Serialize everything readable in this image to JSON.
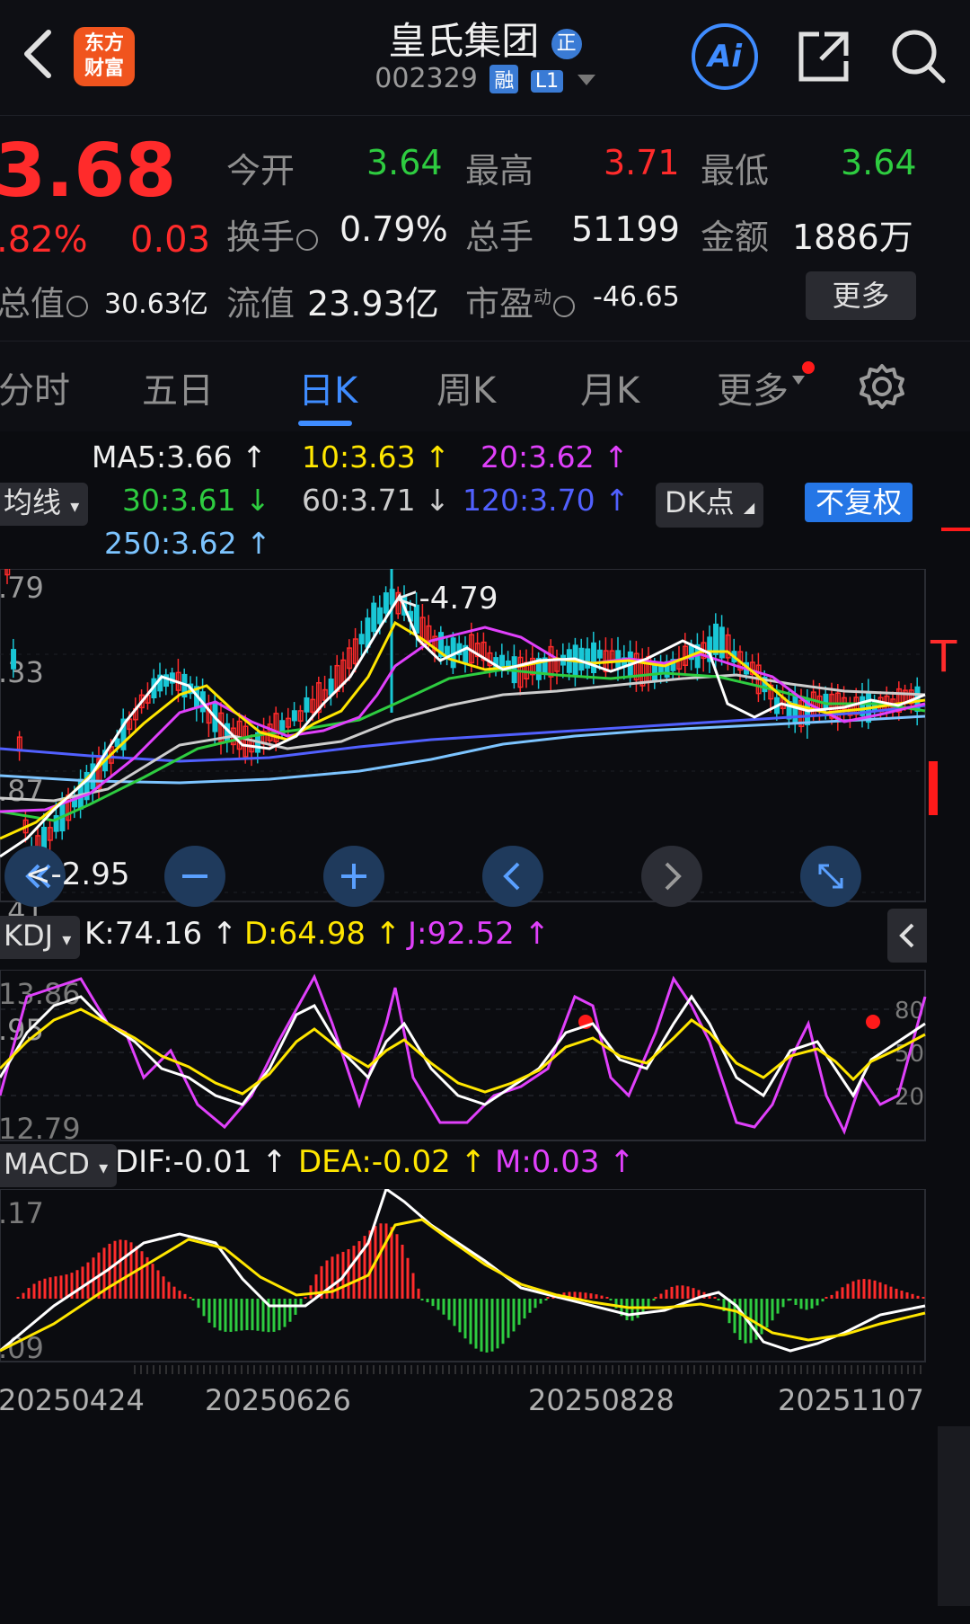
{
  "header": {
    "logo_line1": "东方",
    "logo_line2": "财富",
    "title": "皇氏集团",
    "title_badge": "正",
    "code": "002329",
    "tag_rong": "融",
    "tag_l1": "L1",
    "ai_label": "Ai"
  },
  "quote": {
    "price": "3.68",
    "change_pct": ".82%",
    "change_abs": "0.03",
    "open_label": "今开",
    "open": "3.64",
    "high_label": "最高",
    "high": "3.71",
    "low_label": "最低",
    "low": "3.64",
    "turnover_label": "换手",
    "turnover": "0.79%",
    "volume_label": "总手",
    "volume": "51199",
    "amount_label": "金额",
    "amount": "1886万",
    "mcap_label": "总值",
    "mcap": "30.63亿",
    "float_label": "流值",
    "float_mcap": "23.93亿",
    "pe_label": "市盈",
    "pe_sup": "动",
    "pe": "-46.65",
    "more": "更多"
  },
  "tabs": [
    "分时",
    "五日",
    "日K",
    "周K",
    "月K",
    "更多"
  ],
  "ma": {
    "ma5": "MA5:3.66",
    "ma10": "10:3.63",
    "ma20": "20:3.62",
    "ma30": "30:3.61",
    "ma60": "60:3.71",
    "ma120": "120:3.70",
    "ma250": "250:3.62",
    "selector": "均线",
    "dk": "DK点",
    "fq": "不复权"
  },
  "price_axis": [
    ".79",
    ".33",
    ".87",
    ".41",
    ".95"
  ],
  "annotations": {
    "high": "<-4.79",
    "low": "<-2.95",
    "side_t": "T"
  },
  "kdj": {
    "selector": "KDJ",
    "k": "K:74.16",
    "d": "D:64.98",
    "j": "J:92.52",
    "axis_top": "13.86",
    "axis_bottom": "12.79",
    "right_80": "80",
    "right_50": "50",
    "right_20": "20"
  },
  "macd": {
    "selector": "MACD",
    "dif": "DIF:-0.01",
    "dea": "DEA:-0.02",
    "m": "M:0.03",
    "axis_top": ".17",
    "axis_bottom": ".09"
  },
  "dates": [
    "20250424",
    "20250626",
    "20250828",
    "20251107"
  ],
  "colors": {
    "up": "#ff2b2b",
    "down": "#2ecc40",
    "ma5": "#ffffff",
    "ma10": "#ffe600",
    "ma20": "#e040fb",
    "ma30": "#2ecc40",
    "ma60": "#cccccc",
    "ma120": "#5160ff",
    "ma250": "#7cc4ff"
  }
}
